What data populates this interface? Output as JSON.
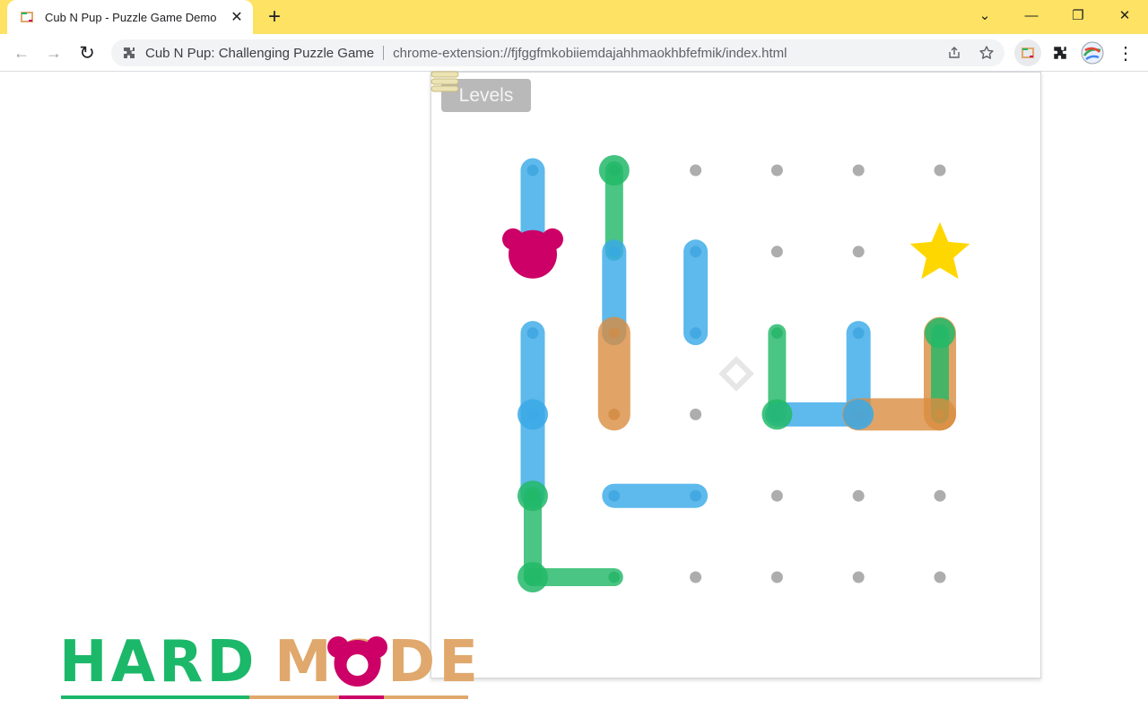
{
  "browser": {
    "tab_title": "Cub N Pup - Puzzle Game Demo",
    "tab_close_glyph": "✕",
    "new_tab_glyph": "+",
    "window_controls": {
      "dropdown": "⌄",
      "minimize": "—",
      "restore": "❐",
      "close": "✕"
    },
    "nav": {
      "back": "←",
      "forward": "→",
      "reload": "↻"
    },
    "omnibox": {
      "site_name": "Cub N Pup: Challenging Puzzle Game",
      "url": "chrome-extension://fjfggfmkobiiemdajahhmaokhbfefmik/index.html"
    },
    "menu_glyph": "⋮",
    "toolbar_icons": [
      "extension-favicon-icon",
      "puzzle-piece-icon",
      "profile-avatar-icon"
    ]
  },
  "game": {
    "levels_label": "Levels",
    "grid": {
      "cols": 6,
      "rows": 6
    },
    "colors": {
      "blue": "#3aa9e8",
      "green": "#22b868",
      "orange": "#d98c40",
      "dot": "#adadad",
      "bear": "#cc0066",
      "star": "#ffd700"
    },
    "pieces": [
      {
        "color": "blue",
        "from": [
          0,
          0
        ],
        "to": [
          0,
          1
        ]
      },
      {
        "color": "green",
        "from": [
          1,
          0
        ],
        "to": [
          1,
          1
        ]
      },
      {
        "color": "blue",
        "from": [
          1,
          1
        ],
        "to": [
          1,
          2
        ]
      },
      {
        "color": "blue",
        "from": [
          2,
          1
        ],
        "to": [
          2,
          2
        ]
      },
      {
        "color": "orange",
        "from": [
          1,
          2
        ],
        "to": [
          1,
          3
        ]
      },
      {
        "color": "blue",
        "from": [
          0,
          2
        ],
        "to": [
          0,
          4
        ]
      },
      {
        "color": "green",
        "from": [
          3,
          2
        ],
        "to": [
          3,
          3
        ]
      },
      {
        "color": "blue",
        "from": [
          4,
          2
        ],
        "to": [
          4,
          3
        ]
      },
      {
        "color": "orange",
        "from": [
          5,
          2
        ],
        "to": [
          5,
          3
        ]
      },
      {
        "color": "green",
        "from": [
          5,
          2
        ],
        "to": [
          5,
          3
        ]
      },
      {
        "color": "blue",
        "from": [
          3,
          3
        ],
        "to": [
          4,
          3
        ]
      },
      {
        "color": "orange",
        "from": [
          4,
          3
        ],
        "to": [
          5,
          3
        ]
      },
      {
        "color": "blue",
        "from": [
          1,
          4
        ],
        "to": [
          2,
          4
        ]
      },
      {
        "color": "green",
        "from": [
          0,
          4
        ],
        "to": [
          0,
          5
        ]
      },
      {
        "color": "green",
        "from": [
          0,
          5
        ],
        "to": [
          1,
          5
        ]
      }
    ],
    "pivots": [
      {
        "color": "green",
        "at": [
          1,
          0
        ]
      },
      {
        "color": "green",
        "at": [
          5,
          2
        ]
      },
      {
        "color": "green",
        "at": [
          3,
          3
        ]
      },
      {
        "color": "blue",
        "at": [
          4,
          3
        ]
      },
      {
        "color": "blue",
        "at": [
          0,
          3
        ]
      },
      {
        "color": "green",
        "at": [
          0,
          4
        ]
      },
      {
        "color": "green",
        "at": [
          0,
          5
        ]
      }
    ],
    "player": {
      "name": "bear",
      "at": [
        0,
        1
      ]
    },
    "goal": {
      "name": "star",
      "at": [
        5,
        1
      ]
    },
    "hint": {
      "name": "diamond-hint",
      "at": [
        2.5,
        2.5
      ]
    }
  },
  "logo": {
    "word1": "HARD",
    "word2": "MODE",
    "colors": {
      "hard": "#1cb86a",
      "mode": "#e0a86c",
      "bear": "#cc0066"
    }
  }
}
